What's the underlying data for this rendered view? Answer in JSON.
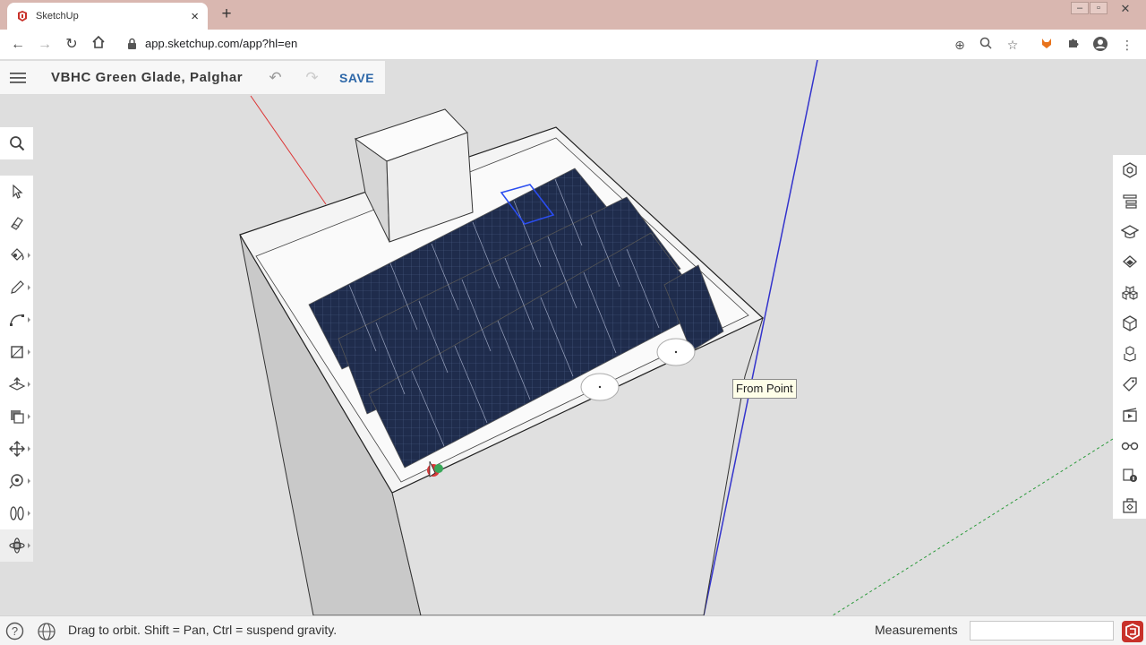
{
  "browser": {
    "tab_title": "SketchUp",
    "url": "app.sketchup.com/app?hl=en",
    "accent": "#c8312a"
  },
  "app": {
    "model_title": "VBHC Green Glade, Palghar",
    "save_label": "SAVE",
    "save_color": "#2d67a8"
  },
  "left_tools": [
    {
      "name": "select-icon"
    },
    {
      "name": "eraser-icon"
    },
    {
      "name": "paint-bucket-icon"
    },
    {
      "name": "pencil-icon"
    },
    {
      "name": "arc-icon"
    },
    {
      "name": "rectangle-icon"
    },
    {
      "name": "push-pull-icon"
    },
    {
      "name": "offset-icon"
    },
    {
      "name": "move-icon"
    },
    {
      "name": "tape-measure-icon"
    },
    {
      "name": "walk-icon"
    },
    {
      "name": "orbit-icon"
    }
  ],
  "right_tools": [
    {
      "name": "entity-info-icon"
    },
    {
      "name": "outliner-icon"
    },
    {
      "name": "instructor-icon"
    },
    {
      "name": "materials-icon"
    },
    {
      "name": "components-icon"
    },
    {
      "name": "styles-icon"
    },
    {
      "name": "layers-icon"
    },
    {
      "name": "tags-icon"
    },
    {
      "name": "scenes-icon"
    },
    {
      "name": "display-icon"
    },
    {
      "name": "solar-north-icon"
    },
    {
      "name": "extension-icon"
    }
  ],
  "viewport": {
    "tooltip": "From Point"
  },
  "status": {
    "hint": "Drag to orbit. Shift = Pan, Ctrl = suspend gravity.",
    "measurements_label": "Measurements",
    "measurements_value": ""
  }
}
